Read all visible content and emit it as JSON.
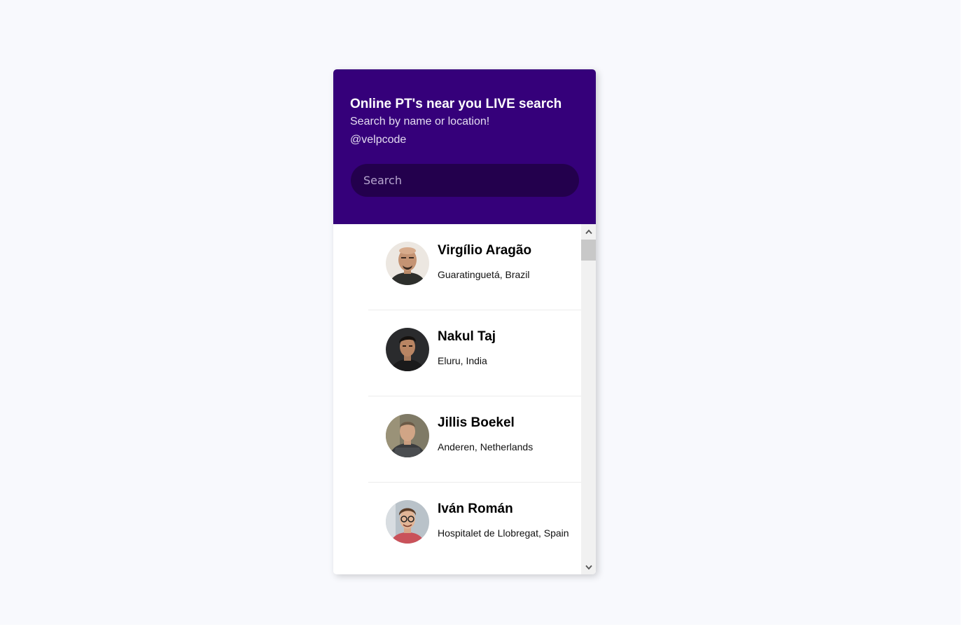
{
  "header": {
    "title": "Online PT's near you LIVE search",
    "subtitle": "Search by name or location!",
    "handle": "@velpcode"
  },
  "search": {
    "placeholder": "Search",
    "value": ""
  },
  "colors": {
    "header_bg": "#35007a",
    "search_bg": "#23004d",
    "page_bg": "#f8f9fd"
  },
  "results": [
    {
      "name": "Virgílio Aragão",
      "location": "Guaratinguetá, Brazil"
    },
    {
      "name": "Nakul Taj",
      "location": "Eluru, India"
    },
    {
      "name": "Jillis Boekel",
      "location": "Anderen, Netherlands"
    },
    {
      "name": "Iván Román",
      "location": "Hospitalet de Llobregat, Spain"
    }
  ],
  "icons": {
    "scroll_up": "chevron-up-icon",
    "scroll_down": "chevron-down-icon"
  }
}
